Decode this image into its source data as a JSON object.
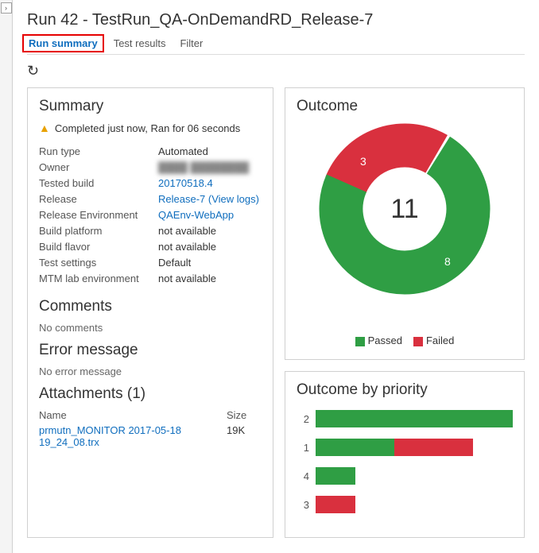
{
  "title": "Run 42 - TestRun_QA-OnDemandRD_Release-7",
  "tabs": {
    "run_summary": "Run summary",
    "test_results": "Test results",
    "filter": "Filter"
  },
  "summary": {
    "heading": "Summary",
    "status_text": "Completed just now, Ran for 06 seconds",
    "fields": {
      "run_type_label": "Run type",
      "run_type_value": "Automated",
      "owner_label": "Owner",
      "owner_value": "████ ████████",
      "tested_build_label": "Tested build",
      "tested_build_value": "20170518.4",
      "release_label": "Release",
      "release_value": "Release-7 (View logs)",
      "release_env_label": "Release Environment",
      "release_env_value": "QAEnv-WebApp",
      "build_platform_label": "Build platform",
      "build_platform_value": "not available",
      "build_flavor_label": "Build flavor",
      "build_flavor_value": "not available",
      "test_settings_label": "Test settings",
      "test_settings_value": "Default",
      "mtm_env_label": "MTM lab environment",
      "mtm_env_value": "not available"
    }
  },
  "comments": {
    "heading": "Comments",
    "empty": "No comments"
  },
  "error": {
    "heading": "Error message",
    "empty": "No error message"
  },
  "attachments": {
    "heading": "Attachments (1)",
    "col_name": "Name",
    "col_size": "Size",
    "items": [
      {
        "name": "prmutn_MONITOR 2017-05-18 19_24_08.trx",
        "size": "19K"
      }
    ]
  },
  "outcome": {
    "heading": "Outcome",
    "total": "11",
    "passed_label": "Passed",
    "failed_label": "Failed",
    "passed_count": "8",
    "failed_count": "3",
    "colors": {
      "pass": "#2f9e44",
      "fail": "#d9303e"
    }
  },
  "priority": {
    "heading": "Outcome by priority",
    "rows": [
      {
        "label": "2"
      },
      {
        "label": "1"
      },
      {
        "label": "4"
      },
      {
        "label": "3"
      }
    ]
  },
  "chart_data": [
    {
      "type": "pie",
      "title": "Outcome",
      "series": [
        {
          "name": "Passed",
          "value": 8,
          "color": "#2f9e44"
        },
        {
          "name": "Failed",
          "value": 3,
          "color": "#d9303e"
        }
      ],
      "total": 11
    },
    {
      "type": "bar",
      "title": "Outcome by priority",
      "categories": [
        "2",
        "1",
        "4",
        "3"
      ],
      "series": [
        {
          "name": "Passed",
          "values": [
            5,
            2,
            1,
            0
          ],
          "color": "#2f9e44"
        },
        {
          "name": "Failed",
          "values": [
            0,
            2,
            0,
            1
          ],
          "color": "#d9303e"
        }
      ],
      "xlim": [
        0,
        5
      ]
    }
  ]
}
